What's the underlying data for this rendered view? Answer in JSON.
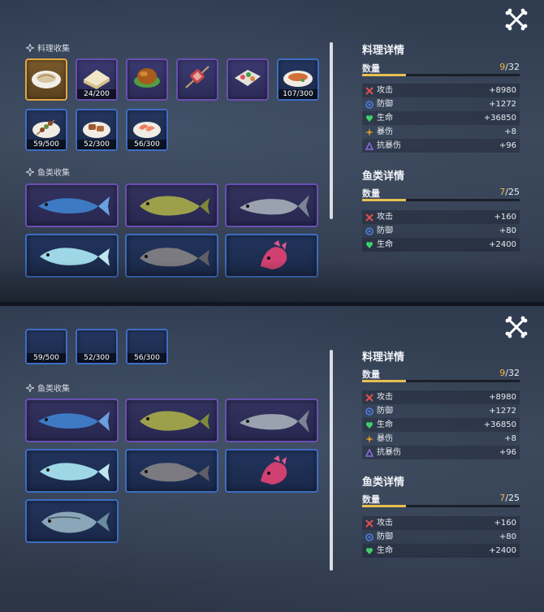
{
  "food_section": {
    "title": "料理收集"
  },
  "fish_section": {
    "title": "鱼类收集"
  },
  "food_items": [
    {
      "name": "fish-fillet-dish",
      "count": "",
      "style": "gold"
    },
    {
      "name": "sandwich",
      "count": "24/200",
      "style": "purple"
    },
    {
      "name": "roast-chicken",
      "count": "",
      "style": "purple"
    },
    {
      "name": "meat-skewer",
      "count": "",
      "style": "purple"
    },
    {
      "name": "sushi-box",
      "count": "",
      "style": "purple"
    },
    {
      "name": "grilled-fish-plate",
      "count": "107/300",
      "style": "blue"
    },
    {
      "name": "kebab-plate",
      "count": "59/500",
      "style": "blue"
    },
    {
      "name": "grilled-meat-plate",
      "count": "52/300",
      "style": "blue"
    },
    {
      "name": "shrimp-plate",
      "count": "56/300",
      "style": "blue"
    }
  ],
  "fish_items": [
    {
      "name": "blue-mackerel",
      "style": "purple"
    },
    {
      "name": "green-bass",
      "style": "purple"
    },
    {
      "name": "grey-salmon",
      "style": "purple"
    },
    {
      "name": "pale-blue-fish",
      "style": "blue"
    },
    {
      "name": "grey-catfish",
      "style": "blue"
    },
    {
      "name": "pink-dragonfish",
      "style": "blue"
    },
    {
      "name": "sea-bream",
      "style": "blue"
    }
  ],
  "food_detail": {
    "title": "料理详情",
    "qty_label": "数量",
    "qty_current": "9",
    "qty_total": "/32",
    "progress": 0.28,
    "stats": [
      {
        "icon": "attack-icon",
        "name": "攻击",
        "value": "+8980",
        "color": "#e05050"
      },
      {
        "icon": "defense-icon",
        "name": "防御",
        "value": "+1272",
        "color": "#4a7fe0"
      },
      {
        "icon": "health-icon",
        "name": "生命",
        "value": "+36850",
        "color": "#3ecf6a"
      },
      {
        "icon": "crit-icon",
        "name": "暴伤",
        "value": "+8",
        "color": "#e0a030"
      },
      {
        "icon": "anti-crit-icon",
        "name": "抗暴伤",
        "value": "+96",
        "color": "#8a6ae0"
      }
    ]
  },
  "fish_detail": {
    "title": "鱼类详情",
    "qty_label": "数量",
    "qty_current": "7",
    "qty_total": "/25",
    "progress": 0.28,
    "stats": [
      {
        "icon": "attack-icon",
        "name": "攻击",
        "value": "+160",
        "color": "#e05050"
      },
      {
        "icon": "defense-icon",
        "name": "防御",
        "value": "+80",
        "color": "#4a7fe0"
      },
      {
        "icon": "health-icon",
        "name": "生命",
        "value": "+2400",
        "color": "#3ecf6a"
      }
    ]
  }
}
